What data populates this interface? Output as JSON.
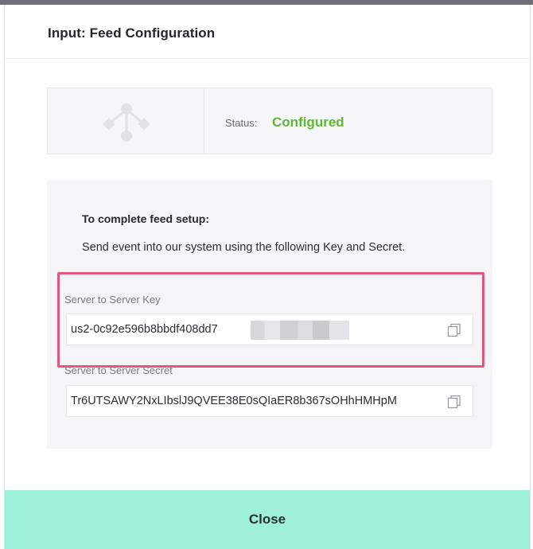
{
  "modal": {
    "title": "Input: Feed Configuration"
  },
  "status": {
    "icon": "feed-node-icon",
    "label": "Status:",
    "value": "Configured",
    "value_color": "#5cb832"
  },
  "setup": {
    "heading": "To complete feed setup:",
    "description": "Send event into our system using the following Key and Secret.",
    "key": {
      "label": "Server to Server Key",
      "value": "us2-0c92e596b8bbdf408dd7",
      "value_redacted": true,
      "copy_icon": "copy-icon"
    },
    "secret": {
      "label": "Server to Server Secret",
      "value": "Tr6UTSAWY2NxLIbslJ9QVEE38E0sQIaER8b367sOHhHMHpM",
      "copy_icon": "copy-icon"
    }
  },
  "footer": {
    "close_label": "Close",
    "close_color": "#9ff0d8"
  },
  "highlight": {
    "color": "#e4557c"
  }
}
